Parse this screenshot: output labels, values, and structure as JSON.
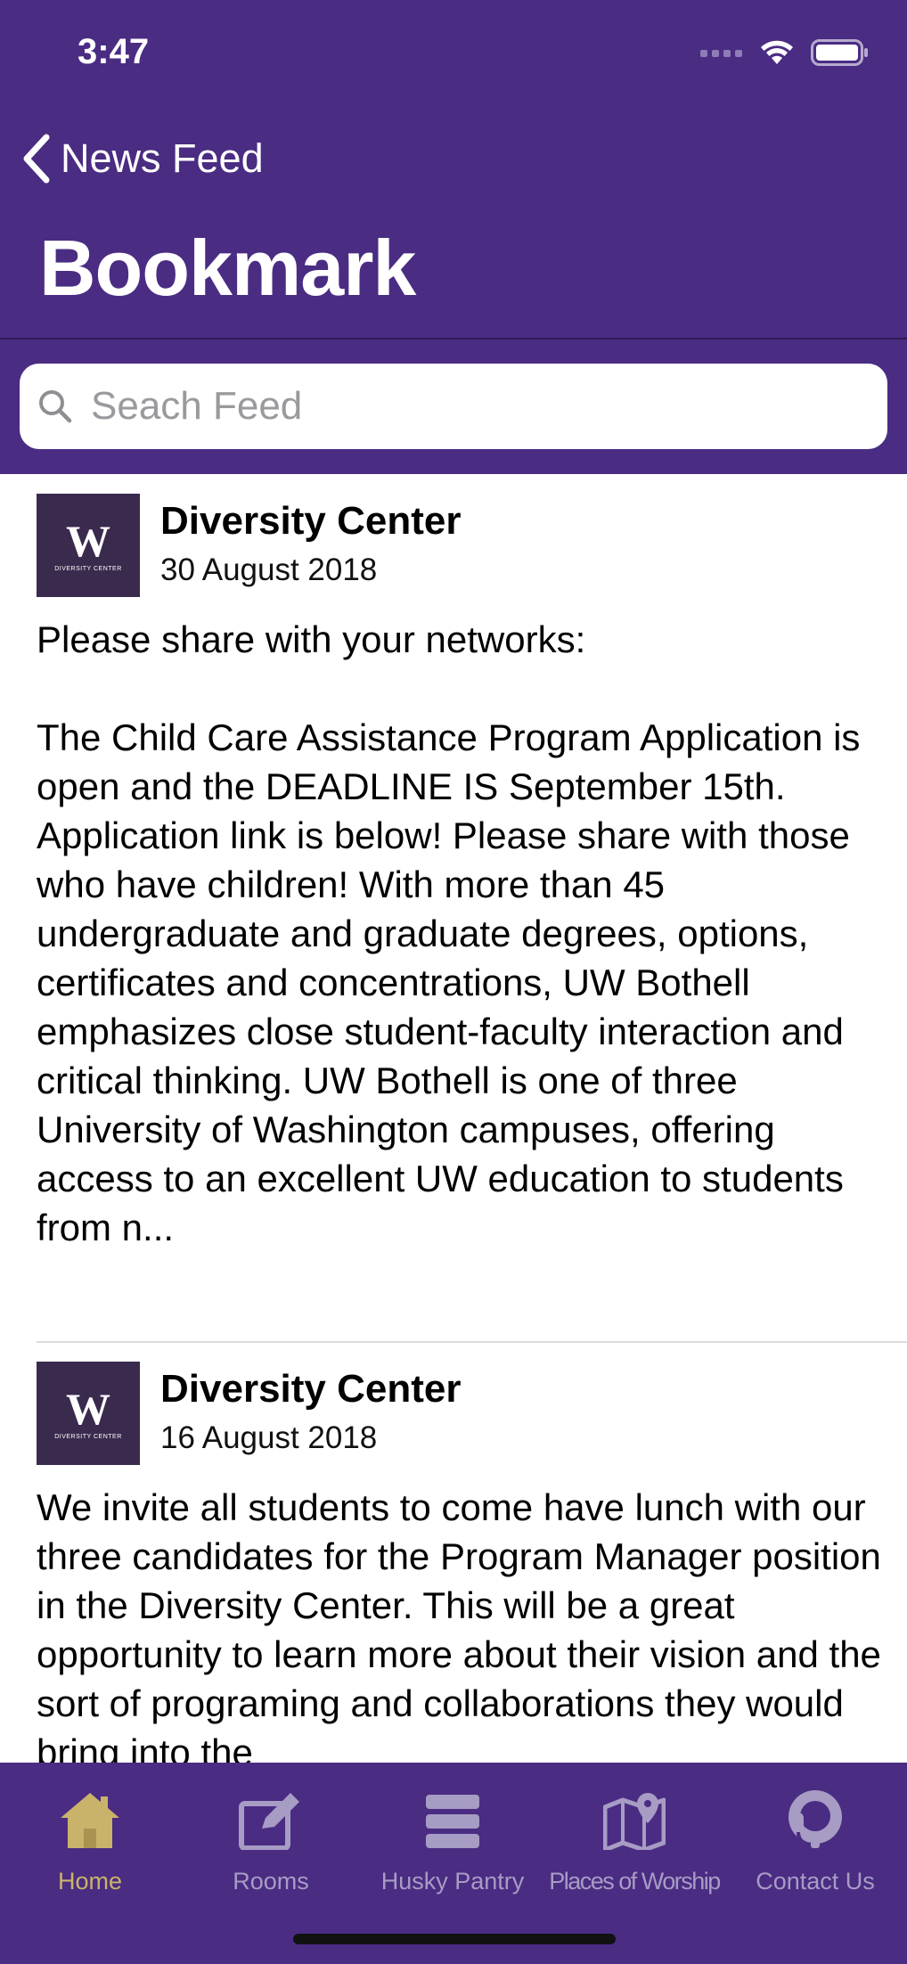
{
  "status": {
    "time": "3:47"
  },
  "nav": {
    "back_label": "News Feed",
    "title": "Bookmark"
  },
  "search": {
    "placeholder": "Seach Feed",
    "value": ""
  },
  "posts": [
    {
      "source": "Diversity Center",
      "date": "30 August 2018",
      "logo_letter": "W",
      "logo_text": "DIVERSITY CENTER",
      "body": "Please share with your networks:\n\nThe Child Care Assistance Program Application is open and the DEADLINE IS September 15th. Application link is below! Please share with those who have children! With more than 45 undergraduate and graduate degrees, options, certificates and concentrations, UW Bothell emphasizes close student-faculty interaction and critical thinking. UW Bothell is one of three University of Washington campuses, offering access to an excellent UW education to students from n..."
    },
    {
      "source": "Diversity Center",
      "date": "16 August 2018",
      "logo_letter": "W",
      "logo_text": "DIVERSITY CENTER",
      "body": "We invite all students to come have lunch with our three candidates for the Program Manager position in the Diversity Center. This will be a great opportunity to learn more about their vision and the sort of programing and collaborations they would bring into the"
    }
  ],
  "tabs": [
    {
      "label": "Home",
      "icon": "home-icon",
      "active": true
    },
    {
      "label": "Rooms",
      "icon": "edit-icon",
      "active": false
    },
    {
      "label": "Husky Pantry",
      "icon": "pantry-icon",
      "active": false
    },
    {
      "label": "Places of Worship",
      "icon": "map-icon",
      "active": false
    },
    {
      "label": "Contact Us",
      "icon": "headset-icon",
      "active": false
    }
  ],
  "colors": {
    "header": "#4a2c83",
    "tab_active": "#c9b36a",
    "tab_inactive": "#a79cc4"
  }
}
